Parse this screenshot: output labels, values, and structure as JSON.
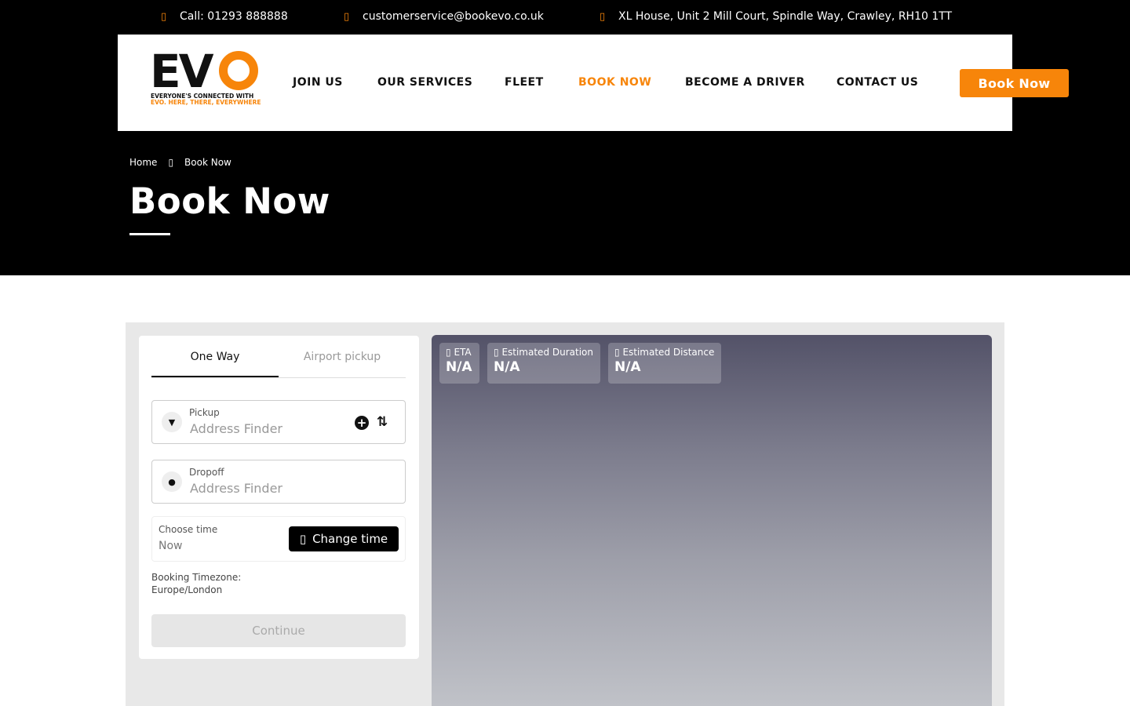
{
  "topbar": {
    "phone": "Call: 01293 888888",
    "email": "customerservice@bookevo.co.uk",
    "address": "XL House, Unit 2 Mill Court, Spindle Way, Crawley, RH10 1TT"
  },
  "logo": {
    "wordmark": "EVO",
    "tagline_1": "EVERYONE'S CONNECTED WITH",
    "tagline_2": "EVO. HERE, THERE, EVERYWHERE"
  },
  "nav": {
    "items": [
      {
        "label": "JOIN US"
      },
      {
        "label": "OUR SERVICES"
      },
      {
        "label": "FLEET"
      },
      {
        "label": "BOOK NOW",
        "active": true
      },
      {
        "label": "BECOME A DRIVER"
      },
      {
        "label": "CONTACT US"
      }
    ],
    "cta": "Book Now"
  },
  "breadcrumb": {
    "home": "Home",
    "current": "Book Now"
  },
  "page_title": "Book Now",
  "booking": {
    "tabs": [
      "One Way",
      "Airport pickup"
    ],
    "pickup": {
      "label": "Pickup",
      "placeholder": "Address Finder"
    },
    "dropoff": {
      "label": "Dropoff",
      "placeholder": "Address Finder"
    },
    "time": {
      "label": "Choose time",
      "value": "Now",
      "button": "Change time"
    },
    "timezone_label": "Booking Timezone:",
    "timezone_value": "Europe/London",
    "continue": "Continue"
  },
  "map_stats": [
    {
      "label": "ETA",
      "value": "N/A"
    },
    {
      "label": "Estimated Duration",
      "value": "N/A"
    },
    {
      "label": "Estimated Distance",
      "value": "N/A"
    }
  ],
  "colors": {
    "accent": "#f7850a",
    "dark": "#000000"
  }
}
